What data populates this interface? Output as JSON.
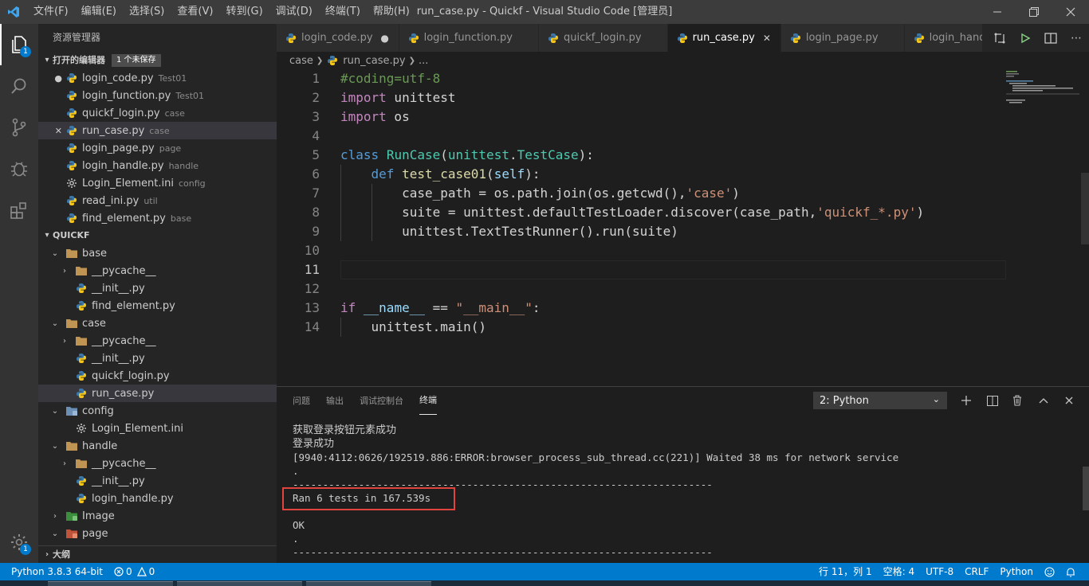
{
  "window": {
    "title": "run_case.py - Quickf - Visual Studio Code [管理员]",
    "menu": [
      "文件(F)",
      "编辑(E)",
      "选择(S)",
      "查看(V)",
      "转到(G)",
      "调试(D)",
      "终端(T)",
      "帮助(H)"
    ]
  },
  "activity_bar": {
    "items": [
      "explorer-icon",
      "search-icon",
      "source-control-icon",
      "debug-icon",
      "extensions-icon"
    ],
    "explorer_badge": "1",
    "settings_badge": "1"
  },
  "sidebar": {
    "title": "资源管理器",
    "open_editors": {
      "header": "打开的编辑器",
      "badge": "1 个未保存",
      "items": [
        {
          "name": "login_code.py",
          "desc": "Test01",
          "lead": "●",
          "icon": "python"
        },
        {
          "name": "login_function.py",
          "desc": "Test01",
          "lead": "",
          "icon": "python"
        },
        {
          "name": "quickf_login.py",
          "desc": "case",
          "lead": "",
          "icon": "python"
        },
        {
          "name": "run_case.py",
          "desc": "case",
          "lead": "✕",
          "icon": "python"
        },
        {
          "name": "login_page.py",
          "desc": "page",
          "lead": "",
          "icon": "python"
        },
        {
          "name": "login_handle.py",
          "desc": "handle",
          "lead": "",
          "icon": "python"
        },
        {
          "name": "Login_Element.ini",
          "desc": "config",
          "lead": "",
          "icon": "gear"
        },
        {
          "name": "read_ini.py",
          "desc": "util",
          "lead": "",
          "icon": "python"
        },
        {
          "name": "find_element.py",
          "desc": "base",
          "lead": "",
          "icon": "python"
        }
      ]
    },
    "folder": {
      "header": "QUICKF",
      "items": [
        {
          "name": "base",
          "type": "folder",
          "twisty": "v",
          "depth": 0
        },
        {
          "name": "__pycache__",
          "type": "folder",
          "twisty": ">",
          "depth": 1
        },
        {
          "name": "__init__.py",
          "type": "python",
          "twisty": "",
          "depth": 1
        },
        {
          "name": "find_element.py",
          "type": "python",
          "twisty": "",
          "depth": 1
        },
        {
          "name": "case",
          "type": "folder",
          "twisty": "v",
          "depth": 0
        },
        {
          "name": "__pycache__",
          "type": "folder",
          "twisty": ">",
          "depth": 1
        },
        {
          "name": "__init__.py",
          "type": "python",
          "twisty": "",
          "depth": 1
        },
        {
          "name": "quickf_login.py",
          "type": "python",
          "twisty": "",
          "depth": 1
        },
        {
          "name": "run_case.py",
          "type": "python",
          "twisty": "",
          "depth": 1
        },
        {
          "name": "config",
          "type": "folder-config",
          "twisty": "v",
          "depth": 0
        },
        {
          "name": "Login_Element.ini",
          "type": "gear",
          "twisty": "",
          "depth": 1
        },
        {
          "name": "handle",
          "type": "folder",
          "twisty": "v",
          "depth": 0
        },
        {
          "name": "__pycache__",
          "type": "folder",
          "twisty": ">",
          "depth": 1
        },
        {
          "name": "__init__.py",
          "type": "python",
          "twisty": "",
          "depth": 1
        },
        {
          "name": "login_handle.py",
          "type": "python",
          "twisty": "",
          "depth": 1
        },
        {
          "name": "Image",
          "type": "folder-image",
          "twisty": ">",
          "depth": 0
        },
        {
          "name": "page",
          "type": "folder-page",
          "twisty": "v",
          "depth": 0
        }
      ]
    },
    "outline_header": "大纲"
  },
  "tabs": [
    {
      "label": "login_code.py",
      "status": "●",
      "active": false
    },
    {
      "label": "login_function.py",
      "status": "",
      "active": false
    },
    {
      "label": "quickf_login.py",
      "status": "",
      "active": false
    },
    {
      "label": "run_case.py",
      "status": "✕",
      "active": true
    },
    {
      "label": "login_page.py",
      "status": "",
      "active": false
    },
    {
      "label": "login_handle.py",
      "status": "",
      "active": false
    }
  ],
  "breadcrumbs": {
    "folder": "case",
    "file": "run_case.py",
    "more": "..."
  },
  "editor": {
    "current_line": 11,
    "lines": [
      {
        "n": "1",
        "indent": 0,
        "tokens": [
          {
            "t": "#coding=utf-8",
            "c": "cmt"
          }
        ]
      },
      {
        "n": "2",
        "indent": 0,
        "tokens": [
          {
            "t": "import",
            "c": "ctl"
          },
          {
            "t": " unittest",
            "c": "plain"
          }
        ]
      },
      {
        "n": "3",
        "indent": 0,
        "tokens": [
          {
            "t": "import",
            "c": "ctl"
          },
          {
            "t": " os",
            "c": "plain"
          }
        ]
      },
      {
        "n": "4",
        "indent": 0,
        "tokens": []
      },
      {
        "n": "5",
        "indent": 0,
        "tokens": [
          {
            "t": "class",
            "c": "kw"
          },
          {
            "t": " ",
            "c": "plain"
          },
          {
            "t": "RunCase",
            "c": "cls"
          },
          {
            "t": "(",
            "c": "plain"
          },
          {
            "t": "unittest",
            "c": "cls"
          },
          {
            "t": ".",
            "c": "plain"
          },
          {
            "t": "TestCase",
            "c": "cls"
          },
          {
            "t": "):",
            "c": "plain"
          }
        ]
      },
      {
        "n": "6",
        "indent": 1,
        "tokens": [
          {
            "t": "    ",
            "c": "plain"
          },
          {
            "t": "def",
            "c": "kw"
          },
          {
            "t": " ",
            "c": "plain"
          },
          {
            "t": "test_case01",
            "c": "fn"
          },
          {
            "t": "(",
            "c": "plain"
          },
          {
            "t": "self",
            "c": "self"
          },
          {
            "t": "):",
            "c": "plain"
          }
        ]
      },
      {
        "n": "7",
        "indent": 2,
        "tokens": [
          {
            "t": "        case_path = os.path.join(os.getcwd(),",
            "c": "plain"
          },
          {
            "t": "'case'",
            "c": "str"
          },
          {
            "t": ")",
            "c": "plain"
          }
        ]
      },
      {
        "n": "8",
        "indent": 2,
        "tokens": [
          {
            "t": "        suite = unittest.defaultTestLoader.discover(case_path,",
            "c": "plain"
          },
          {
            "t": "'quickf_*.py'",
            "c": "str"
          },
          {
            "t": ")",
            "c": "plain"
          }
        ]
      },
      {
        "n": "9",
        "indent": 2,
        "tokens": [
          {
            "t": "        unittest.TextTestRunner().run(suite)",
            "c": "plain"
          }
        ]
      },
      {
        "n": "10",
        "indent": 0,
        "tokens": []
      },
      {
        "n": "11",
        "indent": 0,
        "tokens": []
      },
      {
        "n": "12",
        "indent": 0,
        "tokens": []
      },
      {
        "n": "13",
        "indent": 0,
        "tokens": [
          {
            "t": "if",
            "c": "ctl"
          },
          {
            "t": " ",
            "c": "plain"
          },
          {
            "t": "__name__",
            "c": "var"
          },
          {
            "t": " == ",
            "c": "plain"
          },
          {
            "t": "\"__main__\"",
            "c": "str"
          },
          {
            "t": ":",
            "c": "plain"
          }
        ]
      },
      {
        "n": "14",
        "indent": 1,
        "tokens": [
          {
            "t": "    unittest.main()",
            "c": "plain"
          }
        ]
      }
    ]
  },
  "panel": {
    "tabs": [
      "问题",
      "输出",
      "调试控制台",
      "终端"
    ],
    "active_tab": "终端",
    "terminal_select": "2: Python",
    "terminal_lines": [
      "获取登录按钮元素成功",
      "登录成功",
      "[9940:4112:0626/192519.886:ERROR:browser_process_sub_thread.cc(221)] Waited 38 ms for network service",
      ".",
      "----------------------------------------------------------------------",
      "Ran 6 tests in 167.539s",
      "",
      "OK",
      ".",
      "----------------------------------------------------------------------"
    ]
  },
  "status_bar": {
    "interpreter": "Python 3.8.3 64-bit",
    "errors": "0",
    "warnings": "0",
    "position": "行 11，列 1",
    "spaces": "空格: 4",
    "encoding": "UTF-8",
    "eol": "CRLF",
    "language": "Python"
  },
  "colors": {
    "accent": "#007acc",
    "highlight_box": "#e0443e"
  }
}
